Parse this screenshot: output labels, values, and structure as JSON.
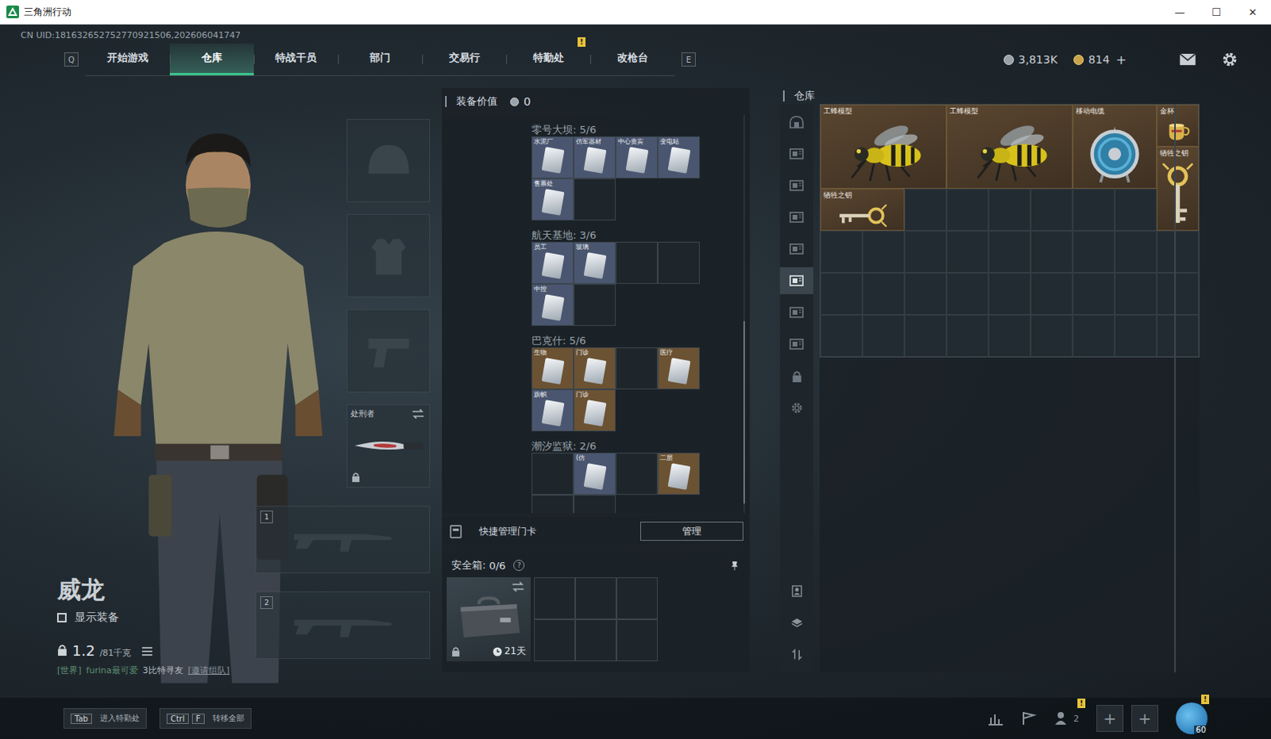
{
  "window": {
    "title": "三角洲行动",
    "controls": [
      "—",
      "☐",
      "✕"
    ]
  },
  "uid": "CN UID:181632652752770921506,202606041747",
  "nav": {
    "left_key": "Q",
    "right_key": "E",
    "tabs": [
      {
        "label": "开始游戏",
        "selected": false,
        "badge": null
      },
      {
        "label": "仓库",
        "selected": true,
        "badge": null
      },
      {
        "label": "特战干员",
        "selected": false,
        "badge": null
      },
      {
        "label": "部门",
        "selected": false,
        "badge": null
      },
      {
        "label": "交易行",
        "selected": false,
        "badge": null
      },
      {
        "label": "特勤处",
        "selected": false,
        "badge": "!"
      },
      {
        "label": "改枪台",
        "selected": false,
        "badge": null
      }
    ]
  },
  "currency": [
    {
      "value": "3,813K",
      "action": null
    },
    {
      "value": "814",
      "action": "+"
    }
  ],
  "character": {
    "name": "威龙",
    "show_gear": {
      "label": "显示装备",
      "checked": false
    },
    "weight": "1.2",
    "weight_max": "/81千克"
  },
  "chat": {
    "channel": "[世界]",
    "text": "furina最可爱",
    "message": "3比特寻友",
    "action": "[邀请组队]"
  },
  "equipment": {
    "melee": {
      "name": "处刑者",
      "locked": true
    },
    "weapon_slots": [
      "1",
      "2"
    ]
  },
  "equipment_value": {
    "label": "装备价值",
    "value": "0"
  },
  "keycards": [
    {
      "map": "零号大坝",
      "count": "5/6",
      "cards": [
        {
          "filled": true,
          "label": "水泥厂",
          "color": "#4a5670"
        },
        {
          "filled": true,
          "label": "仿军器材",
          "color": "#4a5670"
        },
        {
          "filled": true,
          "label": "中心贵宾",
          "color": "#4a5670"
        },
        {
          "filled": true,
          "label": "变电站",
          "color": "#4a5670"
        },
        {
          "filled": true,
          "label": "售票处",
          "color": "#4a5670"
        },
        {
          "filled": false,
          "label": "",
          "color": "#1e262c"
        }
      ]
    },
    {
      "map": "航天基地",
      "count": "3/6",
      "cards": [
        {
          "filled": true,
          "label": "员工",
          "color": "#4a5670"
        },
        {
          "filled": true,
          "label": "玻璃",
          "color": "#4a5670"
        },
        {
          "filled": false,
          "label": "",
          "color": "#1e262c"
        },
        {
          "filled": false,
          "label": "",
          "color": "#1e262c"
        },
        {
          "filled": true,
          "label": "中控",
          "color": "#4a5670"
        },
        {
          "filled": false,
          "label": "",
          "color": "#1e262c"
        }
      ]
    },
    {
      "map": "巴克什",
      "count": "5/6",
      "cards": [
        {
          "filled": true,
          "label": "生物",
          "color": "#6b5232"
        },
        {
          "filled": true,
          "label": "门诊",
          "color": "#6b5232"
        },
        {
          "filled": false,
          "label": "",
          "color": "#1e262c"
        },
        {
          "filled": true,
          "label": "医疗",
          "color": "#6b5232"
        },
        {
          "filled": true,
          "label": "旗帜",
          "color": "#4a5670"
        },
        {
          "filled": true,
          "label": "门诊",
          "color": "#6b5232"
        }
      ]
    },
    {
      "map": "潮汐监狱",
      "count": "2/6",
      "cards": [
        {
          "filled": false,
          "label": "",
          "color": "#1e262c"
        },
        {
          "filled": true,
          "label": "(仿",
          "color": "#4a5670"
        },
        {
          "filled": false,
          "label": "",
          "color": "#1e262c"
        },
        {
          "filled": true,
          "label": "二层",
          "color": "#6b5232"
        },
        {
          "filled": false,
          "label": "",
          "color": "#1e262c"
        },
        {
          "filled": false,
          "label": "",
          "color": "#1e262c"
        }
      ]
    }
  ],
  "quick_manage": {
    "label": "快捷管理门卡",
    "button": "管理"
  },
  "safe_box": {
    "label": "安全箱:",
    "count": "0/6",
    "help": "?",
    "timer": "21天",
    "locked": true,
    "slots": [
      {
        "filled": false
      },
      {
        "filled": false
      },
      {
        "filled": false
      },
      {
        "filled": false
      },
      {
        "filled": false
      },
      {
        "filled": false
      }
    ]
  },
  "warehouse": {
    "title": "仓库",
    "side_tabs": [
      {
        "selected": false
      },
      {
        "selected": false
      },
      {
        "selected": false
      },
      {
        "selected": false
      },
      {
        "selected": false
      },
      {
        "selected": true
      },
      {
        "selected": false
      },
      {
        "selected": false
      }
    ],
    "columns": 9,
    "rows": 6,
    "items": [
      {
        "name": "工蜂模型",
        "kind": "bee",
        "col": 1,
        "row": 1,
        "w": 3,
        "h": 2
      },
      {
        "name": "工蜂模型",
        "kind": "bee",
        "col": 4,
        "row": 1,
        "w": 3,
        "h": 2
      },
      {
        "name": "移动电缆",
        "kind": "reel",
        "col": 7,
        "row": 1,
        "w": 2,
        "h": 2
      },
      {
        "name": "金杯",
        "kind": "cup",
        "col": 9,
        "row": 1,
        "w": 1,
        "h": 1
      },
      {
        "name": "牺牲之钥",
        "kind": "key-v",
        "col": 9,
        "row": 2,
        "w": 1,
        "h": 2
      },
      {
        "name": "牺牲之钥",
        "kind": "key-h",
        "col": 1,
        "row": 3,
        "w": 2,
        "h": 1
      }
    ]
  },
  "bottom_bar": {
    "hints": [
      {
        "keys": [
          "Tab"
        ],
        "label": "进入特勤处"
      },
      {
        "keys": [
          "Ctrl",
          "F"
        ],
        "label": "转移全部"
      }
    ],
    "friends": {
      "count": "2",
      "badge": "!"
    },
    "party_slots": [
      "+",
      "+"
    ],
    "avatar": {
      "level": "60",
      "badge": "!"
    }
  }
}
